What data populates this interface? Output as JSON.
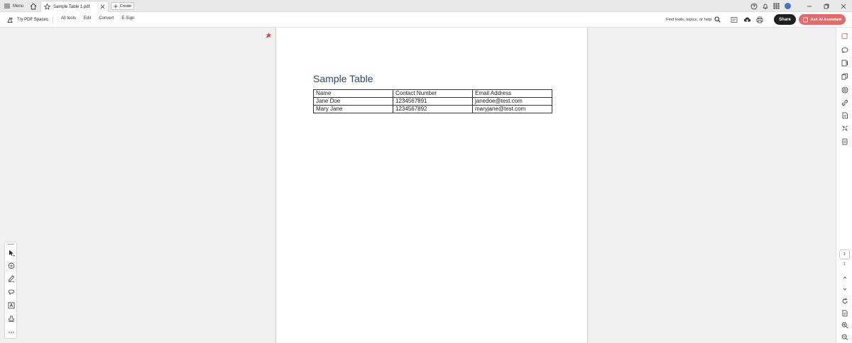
{
  "titlebar": {
    "menu_label": "Menu",
    "tab_title": "Sample Table 1.pdf",
    "create_label": "Create"
  },
  "toolbar": {
    "try_spaces": "Try PDF Spaces",
    "nav": [
      "All tools",
      "Edit",
      "Convert",
      "E-Sign"
    ],
    "search_placeholder": "Find tools, topics, or help",
    "share_label": "Share",
    "ask_ai_label": "Ask AI Assistant"
  },
  "document": {
    "title": "Sample Table",
    "table": {
      "headers": [
        "Name",
        "Contact Number",
        "Email Address"
      ],
      "rows": [
        [
          "Jane Doe",
          "1234567891",
          "janedoe@test.com"
        ],
        [
          "Mary Jane",
          "1234567892",
          "maryjane@test.com"
        ]
      ]
    }
  },
  "navigation": {
    "current_page": "1",
    "total_pages": "1"
  },
  "colors": {
    "accent": "#e06b6b",
    "share_bg": "#1f1f1f",
    "title_color": "#2c4a6b",
    "avatar": "#4a72c4",
    "sticky_note": "#d24b4b"
  }
}
